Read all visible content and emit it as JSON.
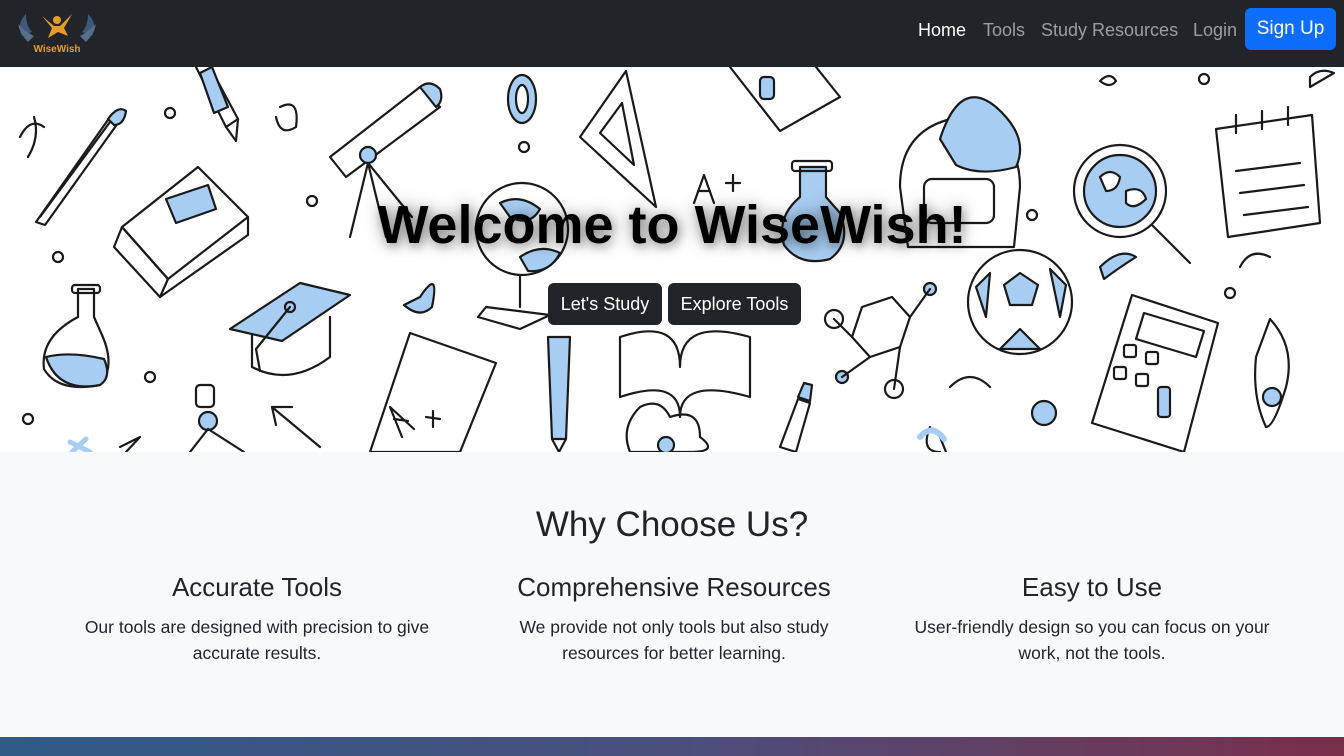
{
  "navbar": {
    "logo_text": "WiseWish",
    "links": [
      {
        "label": "Home"
      },
      {
        "label": "Tools"
      },
      {
        "label": "Study Resources"
      },
      {
        "label": "Login"
      }
    ],
    "signup_label": "Sign Up"
  },
  "hero": {
    "title": "Welcome to WiseWish!",
    "buttons": [
      {
        "label": "Let's Study"
      },
      {
        "label": "Explore Tools"
      }
    ]
  },
  "why": {
    "title": "Why Choose Us?",
    "features": [
      {
        "title": "Accurate Tools",
        "text": "Our tools are designed with precision to give accurate results."
      },
      {
        "title": "Comprehensive Resources",
        "text": "We provide not only tools but also study resources for better learning."
      },
      {
        "title": "Easy to Use",
        "text": "User-friendly design so you can focus on your work, not the tools."
      }
    ]
  },
  "colors": {
    "navbar_bg": "#212529",
    "primary": "#0d6efd",
    "doodle_fill": "#a8cdf2"
  }
}
